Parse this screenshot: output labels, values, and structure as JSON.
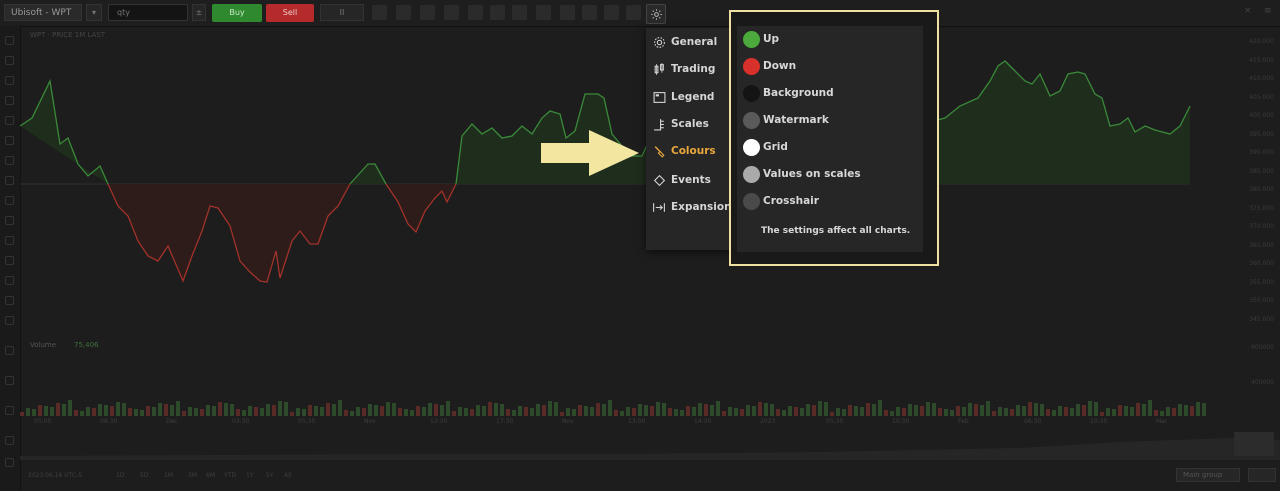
{
  "toolbar": {
    "symbol": "Ubisoft - WPT",
    "qty_prefix": "qty",
    "buy_label": "Buy",
    "sell_label": "Sell",
    "toggle_label": "II",
    "close_glyph": "×",
    "menu_glyph": "≡"
  },
  "chart": {
    "series_label": "WPT · PRICE 1M LAST",
    "volume_label": "Volume",
    "volume_value": "75,406",
    "up_color": "#3a8a3a",
    "down_color": "#a2322a",
    "price_axis_ticks": [
      "420.000",
      "415.000",
      "410.000",
      "405.000",
      "400.000",
      "395.000",
      "390.000",
      "385.000",
      "380.000",
      "375.000",
      "370.000",
      "365.000",
      "360.000",
      "355.000",
      "350.000",
      "345.000"
    ],
    "volume_axis_ticks": [
      "600000",
      "400000"
    ],
    "time_ticks": [
      "05:00",
      "08:30",
      "Dec",
      "03:30",
      "05:30",
      "Nov",
      "12:30",
      "17:30",
      "Nov",
      "13:00",
      "14:30",
      "2023",
      "05:30",
      "10:30",
      "Feb",
      "06:30",
      "10:30",
      "Mar"
    ],
    "bottom_items": [
      "2023.06.16 UTC-5",
      "1D",
      "5D",
      "1M",
      "3M",
      "6M",
      "YTD",
      "1Y",
      "5Y",
      "All"
    ],
    "bottom_select": "Main group"
  },
  "settings_menu": {
    "items": [
      {
        "label": "General",
        "icon": "gear-icon"
      },
      {
        "label": "Trading",
        "icon": "candles-icon"
      },
      {
        "label": "Legend",
        "icon": "legend-icon"
      },
      {
        "label": "Scales",
        "icon": "scales-icon"
      },
      {
        "label": "Colours",
        "icon": "paint-brush-icon",
        "active": true
      },
      {
        "label": "Events",
        "icon": "diamond-icon"
      },
      {
        "label": "Expansion",
        "icon": "expand-icon"
      }
    ],
    "active_color": "#e9a83b"
  },
  "colours_panel": {
    "items": [
      {
        "label": "Up",
        "color": "#4caa3c"
      },
      {
        "label": "Down",
        "color": "#d8302a"
      },
      {
        "label": "Background",
        "color": "#141414"
      },
      {
        "label": "Watermark",
        "color": "#5a5a5a"
      },
      {
        "label": "Grid",
        "color": "#ffffff"
      },
      {
        "label": "Values on scales",
        "color": "#aaaaaa"
      },
      {
        "label": "Crosshair",
        "color": "#4a4a4a"
      }
    ],
    "note": "The settings affect all charts.",
    "frame_color": "#efe1a1"
  },
  "annotation": {
    "arrow_color": "#f2e6a0"
  }
}
